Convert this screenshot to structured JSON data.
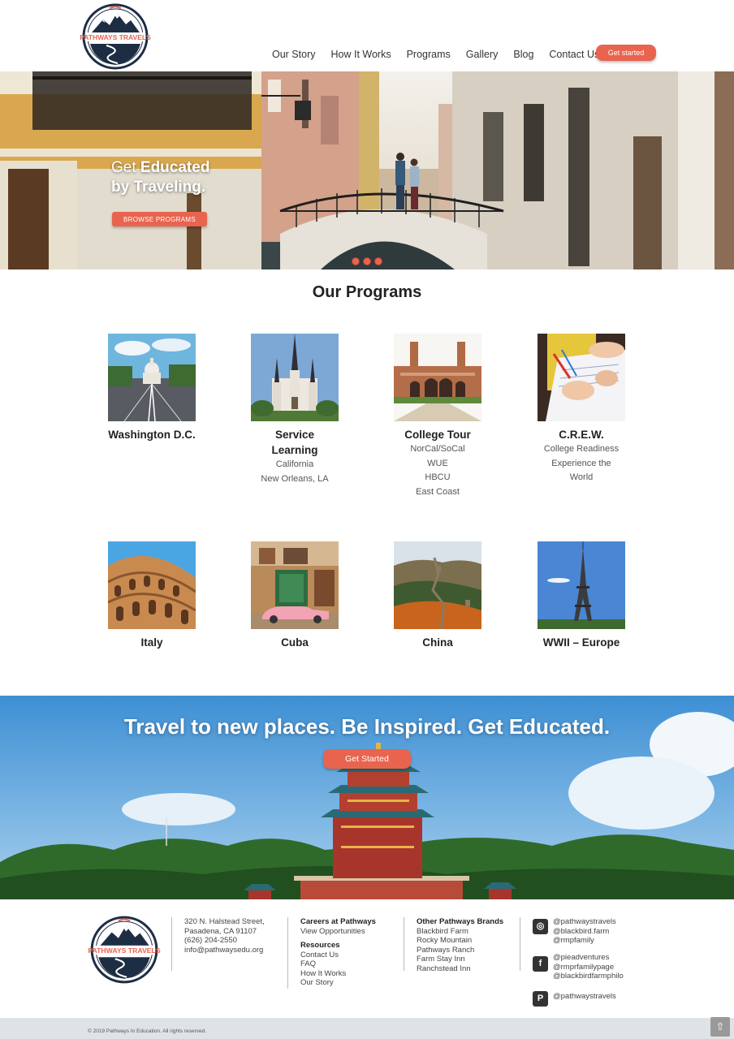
{
  "brand": {
    "name": "PATHWAYS TRAVELS",
    "accent": "#e8644f",
    "navy": "#1d2d44"
  },
  "nav": {
    "items": [
      "Our Story",
      "How It Works",
      "Programs",
      "Gallery",
      "Blog",
      "Contact Us"
    ],
    "cta": "Get started"
  },
  "hero": {
    "line1_pre": "Get ",
    "line1_bold": "Educated",
    "line2": "by Traveling.",
    "button": "BROWSE PROGRAMS",
    "slide_dots": 3
  },
  "programs": {
    "title": "Our Programs",
    "items": [
      {
        "name": "Washington D.C.",
        "details": []
      },
      {
        "name": "Service Learning",
        "details": [
          "California",
          "New Orleans, LA"
        ]
      },
      {
        "name": "College Tour",
        "details": [
          "NorCal/SoCal",
          "WUE",
          "HBCU",
          "East Coast"
        ]
      },
      {
        "name": "C.R.E.W.",
        "details": [
          "College Readiness",
          "Experience the",
          "World"
        ]
      },
      {
        "name": "Italy",
        "details": []
      },
      {
        "name": "Cuba",
        "details": []
      },
      {
        "name": "China",
        "details": []
      },
      {
        "name": "WWII – Europe",
        "details": []
      }
    ]
  },
  "banner": {
    "title": "Travel to new places. Be Inspired. Get Educated.",
    "button": "Get Started"
  },
  "footer": {
    "address": [
      "320 N. Halstead Street,",
      "Pasadena, CA 91107",
      "(626) 204-2550",
      "info@pathwaysedu.org"
    ],
    "careers_heading": "Careers at Pathways",
    "careers_link": "View Opportunities",
    "resources_heading": "Resources",
    "resources_links": [
      "Contact Us",
      "FAQ",
      "How It Works",
      "Our Story"
    ],
    "brands_heading": "Other Pathways Brands",
    "brands": [
      "Blackbird Farm",
      "Rocky Mountain",
      "Pathways Ranch",
      "Farm Stay Inn",
      "Ranchstead Inn"
    ],
    "instagram": [
      "@pathwaystravels",
      "@blackbird.farm",
      "@rmpfamily"
    ],
    "facebook": [
      "@pieadventures",
      "@rmprfamilypage",
      "@blackbirdfarmphilo"
    ],
    "pinterest": [
      "@pathwaystravels"
    ],
    "copyright": "© 2019 Pathways In Education. All rights reserved.",
    "to_top_icon": "arrow-up-icon"
  }
}
